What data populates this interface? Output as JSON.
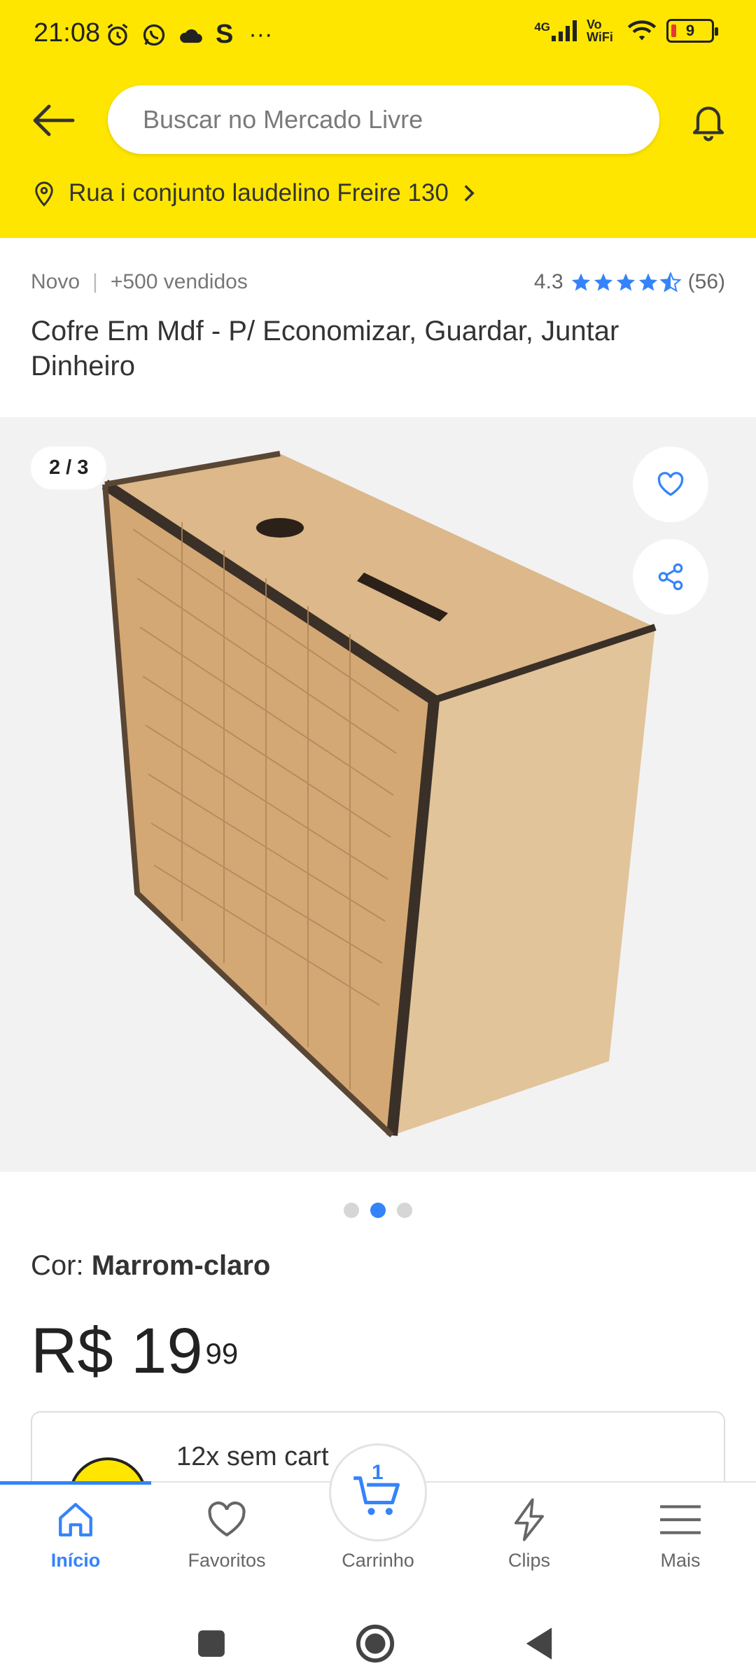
{
  "status_bar": {
    "time": "21:08",
    "network": "4G",
    "vowifi": "Vo WiFi",
    "battery": "9",
    "more": "···"
  },
  "header": {
    "search_placeholder": "Buscar no Mercado Livre",
    "address": "Rua i conjunto laudelino Freire 130"
  },
  "product": {
    "condition": "Novo",
    "sold": "+500 vendidos",
    "rating_value": "4.3",
    "rating_count": "(56)",
    "rating_stars": 4.3,
    "title": "Cofre Em Mdf - P/ Economizar, Guardar, Juntar Dinheiro",
    "image_counter": "2 / 3",
    "color_label": "Cor: ",
    "color_value": "Marrom-claro",
    "price_main": "R$ 19",
    "price_cents": "99",
    "installments": "12x sem cart"
  },
  "bottom_nav": {
    "items": [
      {
        "label": "Início",
        "icon": "home-icon",
        "active": true
      },
      {
        "label": "Favoritos",
        "icon": "heart-icon"
      },
      {
        "label": "Carrinho",
        "icon": "cart-icon"
      },
      {
        "label": "Clips",
        "icon": "lightning-icon"
      },
      {
        "label": "Mais",
        "icon": "menu-icon"
      }
    ],
    "cart_count": "1"
  },
  "colors": {
    "brand_yellow": "#FFE600",
    "accent_blue": "#3483FA"
  }
}
